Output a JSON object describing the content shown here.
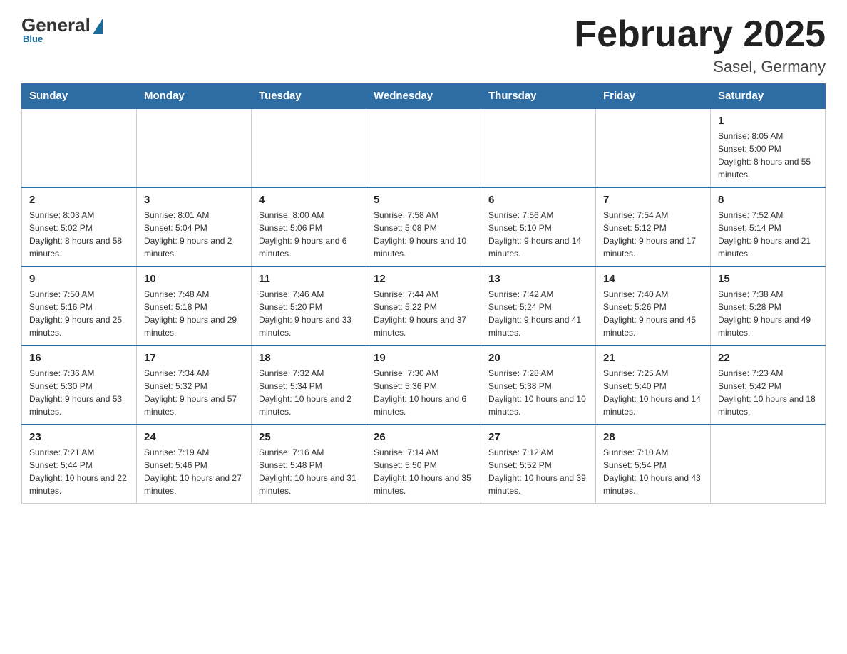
{
  "header": {
    "logo": {
      "general": "General",
      "blue": "Blue",
      "sub": "Blue"
    },
    "title": "February 2025",
    "location": "Sasel, Germany"
  },
  "days_of_week": [
    "Sunday",
    "Monday",
    "Tuesday",
    "Wednesday",
    "Thursday",
    "Friday",
    "Saturday"
  ],
  "weeks": [
    [
      {
        "day": "",
        "info": ""
      },
      {
        "day": "",
        "info": ""
      },
      {
        "day": "",
        "info": ""
      },
      {
        "day": "",
        "info": ""
      },
      {
        "day": "",
        "info": ""
      },
      {
        "day": "",
        "info": ""
      },
      {
        "day": "1",
        "info": "Sunrise: 8:05 AM\nSunset: 5:00 PM\nDaylight: 8 hours and 55 minutes."
      }
    ],
    [
      {
        "day": "2",
        "info": "Sunrise: 8:03 AM\nSunset: 5:02 PM\nDaylight: 8 hours and 58 minutes."
      },
      {
        "day": "3",
        "info": "Sunrise: 8:01 AM\nSunset: 5:04 PM\nDaylight: 9 hours and 2 minutes."
      },
      {
        "day": "4",
        "info": "Sunrise: 8:00 AM\nSunset: 5:06 PM\nDaylight: 9 hours and 6 minutes."
      },
      {
        "day": "5",
        "info": "Sunrise: 7:58 AM\nSunset: 5:08 PM\nDaylight: 9 hours and 10 minutes."
      },
      {
        "day": "6",
        "info": "Sunrise: 7:56 AM\nSunset: 5:10 PM\nDaylight: 9 hours and 14 minutes."
      },
      {
        "day": "7",
        "info": "Sunrise: 7:54 AM\nSunset: 5:12 PM\nDaylight: 9 hours and 17 minutes."
      },
      {
        "day": "8",
        "info": "Sunrise: 7:52 AM\nSunset: 5:14 PM\nDaylight: 9 hours and 21 minutes."
      }
    ],
    [
      {
        "day": "9",
        "info": "Sunrise: 7:50 AM\nSunset: 5:16 PM\nDaylight: 9 hours and 25 minutes."
      },
      {
        "day": "10",
        "info": "Sunrise: 7:48 AM\nSunset: 5:18 PM\nDaylight: 9 hours and 29 minutes."
      },
      {
        "day": "11",
        "info": "Sunrise: 7:46 AM\nSunset: 5:20 PM\nDaylight: 9 hours and 33 minutes."
      },
      {
        "day": "12",
        "info": "Sunrise: 7:44 AM\nSunset: 5:22 PM\nDaylight: 9 hours and 37 minutes."
      },
      {
        "day": "13",
        "info": "Sunrise: 7:42 AM\nSunset: 5:24 PM\nDaylight: 9 hours and 41 minutes."
      },
      {
        "day": "14",
        "info": "Sunrise: 7:40 AM\nSunset: 5:26 PM\nDaylight: 9 hours and 45 minutes."
      },
      {
        "day": "15",
        "info": "Sunrise: 7:38 AM\nSunset: 5:28 PM\nDaylight: 9 hours and 49 minutes."
      }
    ],
    [
      {
        "day": "16",
        "info": "Sunrise: 7:36 AM\nSunset: 5:30 PM\nDaylight: 9 hours and 53 minutes."
      },
      {
        "day": "17",
        "info": "Sunrise: 7:34 AM\nSunset: 5:32 PM\nDaylight: 9 hours and 57 minutes."
      },
      {
        "day": "18",
        "info": "Sunrise: 7:32 AM\nSunset: 5:34 PM\nDaylight: 10 hours and 2 minutes."
      },
      {
        "day": "19",
        "info": "Sunrise: 7:30 AM\nSunset: 5:36 PM\nDaylight: 10 hours and 6 minutes."
      },
      {
        "day": "20",
        "info": "Sunrise: 7:28 AM\nSunset: 5:38 PM\nDaylight: 10 hours and 10 minutes."
      },
      {
        "day": "21",
        "info": "Sunrise: 7:25 AM\nSunset: 5:40 PM\nDaylight: 10 hours and 14 minutes."
      },
      {
        "day": "22",
        "info": "Sunrise: 7:23 AM\nSunset: 5:42 PM\nDaylight: 10 hours and 18 minutes."
      }
    ],
    [
      {
        "day": "23",
        "info": "Sunrise: 7:21 AM\nSunset: 5:44 PM\nDaylight: 10 hours and 22 minutes."
      },
      {
        "day": "24",
        "info": "Sunrise: 7:19 AM\nSunset: 5:46 PM\nDaylight: 10 hours and 27 minutes."
      },
      {
        "day": "25",
        "info": "Sunrise: 7:16 AM\nSunset: 5:48 PM\nDaylight: 10 hours and 31 minutes."
      },
      {
        "day": "26",
        "info": "Sunrise: 7:14 AM\nSunset: 5:50 PM\nDaylight: 10 hours and 35 minutes."
      },
      {
        "day": "27",
        "info": "Sunrise: 7:12 AM\nSunset: 5:52 PM\nDaylight: 10 hours and 39 minutes."
      },
      {
        "day": "28",
        "info": "Sunrise: 7:10 AM\nSunset: 5:54 PM\nDaylight: 10 hours and 43 minutes."
      },
      {
        "day": "",
        "info": ""
      }
    ]
  ]
}
